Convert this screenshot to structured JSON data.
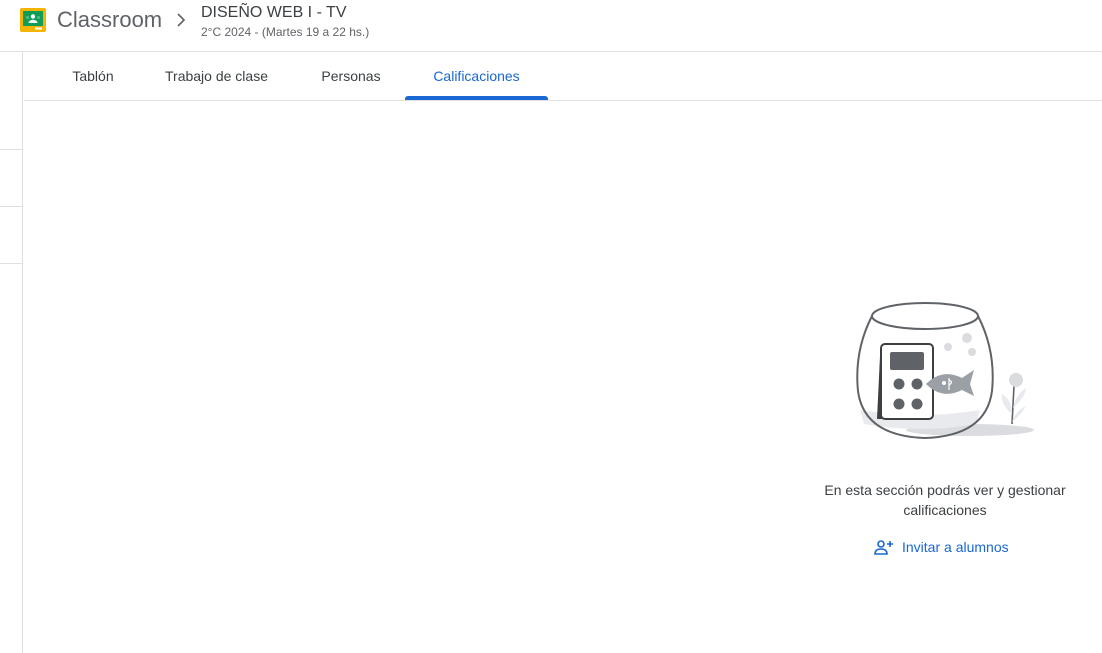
{
  "header": {
    "app_name": "Classroom",
    "class_title": "DISEÑO WEB I - TV",
    "class_subtitle": "2°C 2024 - (Martes 19 a 22 hs.)"
  },
  "tabs": [
    {
      "label": "Tablón",
      "active": false
    },
    {
      "label": "Trabajo de clase",
      "active": false
    },
    {
      "label": "Personas",
      "active": false
    },
    {
      "label": "Calificaciones",
      "active": true
    }
  ],
  "empty_state": {
    "message": "En esta sección podrás ver y gestionar calificaciones",
    "invite_label": "Invitar a alumnos"
  },
  "colors": {
    "accent": "#1967d2",
    "logo_green": "#0f9d58",
    "logo_yellow": "#f4b400",
    "divider": "#e0e0e0"
  }
}
